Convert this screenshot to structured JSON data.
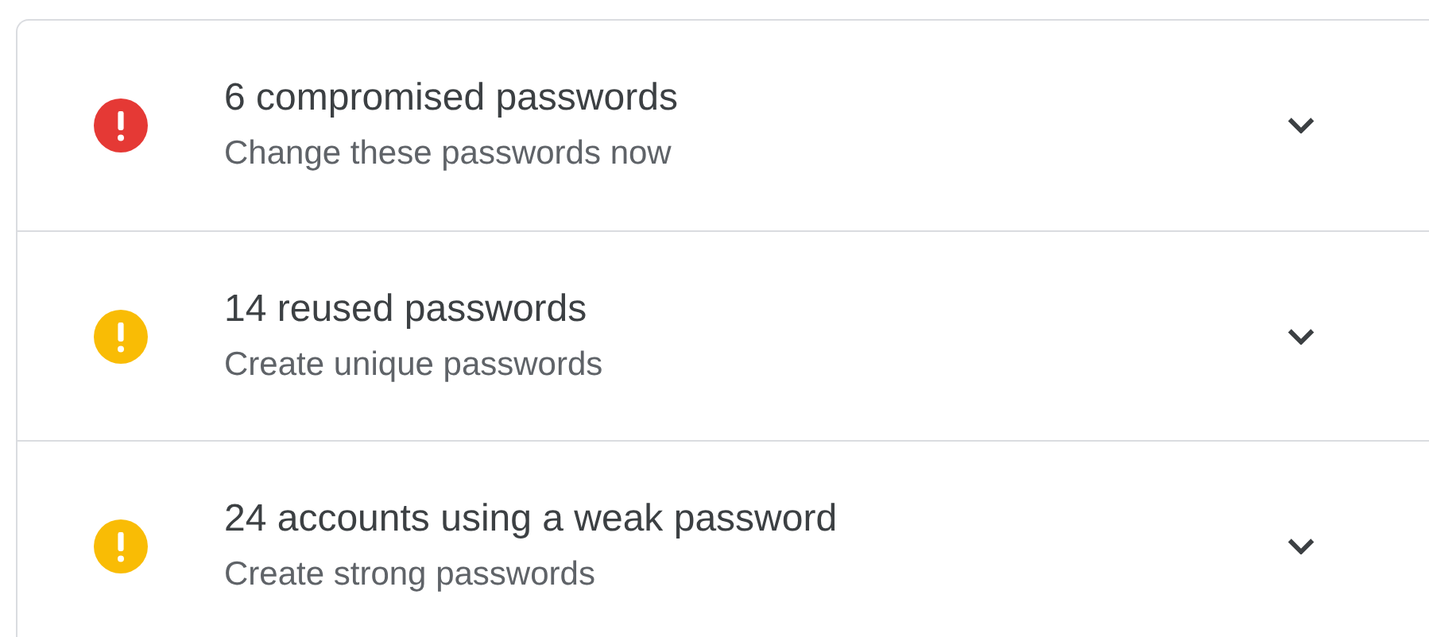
{
  "issues": [
    {
      "title": "6 compromised passwords",
      "subtitle": "Change these passwords now",
      "color": "#e53935",
      "expanded": false
    },
    {
      "title": "14 reused passwords",
      "subtitle": "Create unique passwords",
      "color": "#f9bc05",
      "expanded": false
    },
    {
      "title": "24 accounts using a weak password",
      "subtitle": "Create strong passwords",
      "color": "#f9bc05",
      "expanded": false
    }
  ]
}
